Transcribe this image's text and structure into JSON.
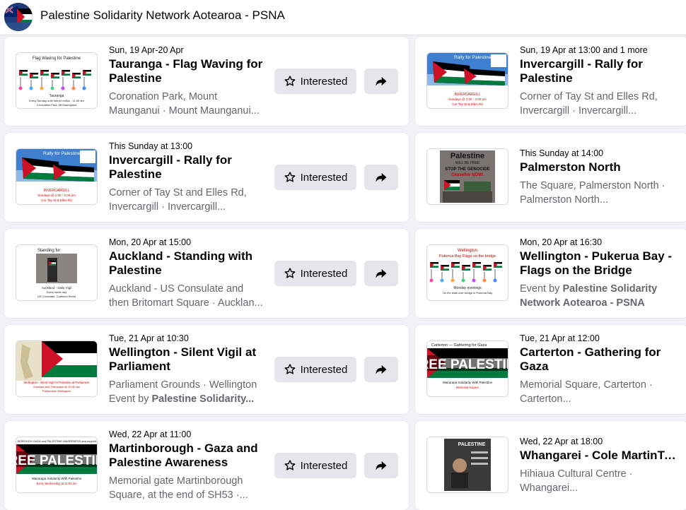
{
  "page": {
    "title": "Palestine Solidarity Network Aotearoa - PSNA",
    "interested_label": "Interested"
  },
  "colors": {
    "page_bg": "#f0f2f5",
    "button_bg": "#e4e6eb",
    "meta_text": "#65676b",
    "flag_red": "#ce1126",
    "flag_green": "#007a3d",
    "flag_black": "#000000"
  },
  "events": [
    {
      "date": "Sun, 19 Apr-20 Apr",
      "title_lines": [
        "Tauranga - Flag Waving for",
        "Palestine"
      ],
      "meta_lines": [
        "Coronation Park, Mount",
        "Maunganui · Mount Maunganui..."
      ],
      "thumb": {
        "heading": "Flag Waving for Palestine",
        "caption1": "Tauranga",
        "caption2": "Every Sunday until further notice - 11:00 am",
        "caption3": "Coronation Park, Mt Maunganui"
      },
      "has_actions": true
    },
    {
      "date": "Sun, 19 Apr at 13:00 and 1 more",
      "title_lines": [
        "Invercargill - Rally for",
        "Palestine"
      ],
      "meta_lines": [
        "Corner of Tay St and Elles Rd,",
        "Invercargill · Invercargill..."
      ],
      "thumb": {
        "heading": "Rally for Palestine",
        "caption1": "INVERCARGILL",
        "caption2": "Sundays @ 1:00 - 2:00 pm",
        "caption3": "Cnr Tay St & Elles Rd"
      },
      "has_actions": false
    },
    {
      "date": "This Sunday at 13:00",
      "title_lines": [
        "Invercargill - Rally for",
        "Palestine"
      ],
      "meta_lines": [
        "Corner of Tay St and Elles Rd,",
        "Invercargill · Invercargill..."
      ],
      "thumb": {
        "heading": "Rally for Palestine",
        "caption1": "INVERCARGILL",
        "caption2": "Sundays @ 1:00 - 2:00 pm",
        "caption3": "Cnr Tay St & Elles Rd"
      },
      "has_actions": true
    },
    {
      "date": "This Sunday at 14:00",
      "title_lines": [
        "Palmerston North"
      ],
      "meta_lines": [
        "The Square, Palmerston North ·",
        "Palmerston North..."
      ],
      "thumb": {
        "heading": "Palestine",
        "caption1": "WILL BE FREE",
        "caption2": "STOP THE GENOCIDE",
        "caption3": "Ceasefire NOW!"
      },
      "has_actions": false
    },
    {
      "date": "Mon, 20 Apr at 15:00",
      "title_lines": [
        "Auckland - Standing with",
        "Palestine"
      ],
      "meta_lines": [
        "Auckland - US Consulate and",
        "then Britomart Square · Aucklan..."
      ],
      "thumb": {
        "heading": "Standing for",
        "caption1": "Auckland - Daily Vigil",
        "caption2": "Every week day",
        "caption3": "US Consulate, Customs Street"
      },
      "has_actions": true
    },
    {
      "date": "Mon, 20 Apr at 16:30",
      "title_lines": [
        "Wellington - Pukerua Bay -",
        "Flags on the Bridge"
      ],
      "meta_prefix": "Event by ",
      "meta_bold_lines": [
        "Palestine Solidarity",
        "Network Aotearoa - PSNA"
      ],
      "thumb": {
        "heading": "Wellington",
        "caption1": "Pukerua Bay Flags on the bridge",
        "caption2": "Monday evenings",
        "caption3": "On the walk over bridge in Pukerua Bay"
      },
      "has_actions": false
    },
    {
      "date": "Tue, 21 Apr at 10:30",
      "title_lines": [
        "Wellington - Silent Vigil at",
        "Parliament"
      ],
      "meta_lines": [
        "Parliament Grounds · Wellington"
      ],
      "meta_prefix2": "Event by ",
      "meta_bold2": "Palestine Solidarity...",
      "thumb": {
        "heading": "",
        "caption1": "Wellington - Silent Vigil for Palestine at Parliament",
        "caption2": "Sundays and Thursdays @ 10:30 am",
        "caption3": "Parliament, Wellington"
      },
      "has_actions": true
    },
    {
      "date": "Tue, 21 Apr at 12:00",
      "title_lines": [
        "Carterton - Gathering for",
        "Gaza"
      ],
      "meta_lines": [
        "Memorial Square, Carterton ·",
        "Carterton..."
      ],
      "thumb": {
        "heading": "Carterton — Gathering for Gaza",
        "caption1": "REE PALESTIN",
        "caption2": "Wairarapa Solidarity With Palestine",
        "caption3": "Memorial Square"
      },
      "has_actions": false
    },
    {
      "date": "Wed, 22 Apr at 11:00",
      "title_lines": [
        "Martinborough - Gaza and",
        "Palestine Awareness"
      ],
      "meta_lines": [
        "Memorial gate Martinborough",
        "Square, at the end of SH53 ·..."
      ],
      "thumb": {
        "heading": "BOROUGH GAZA and PALESTINE AWARENESS and support",
        "caption1": "REE PALESTIN",
        "caption2": "Wairarapa Solidarity With Palestine",
        "caption3": "Every Wednesday at 11:00 am"
      },
      "has_actions": true
    },
    {
      "date": "Wed, 22 Apr at 18:00",
      "title_lines": [
        "Whangarei - Cole MartinTalk"
      ],
      "meta_lines": [
        "Hihiaua Cultural Centre ·",
        "Whangarei..."
      ],
      "thumb": {
        "heading": "PALESTINE",
        "caption1": "",
        "caption2": "",
        "caption3": ""
      },
      "has_actions": false
    }
  ]
}
